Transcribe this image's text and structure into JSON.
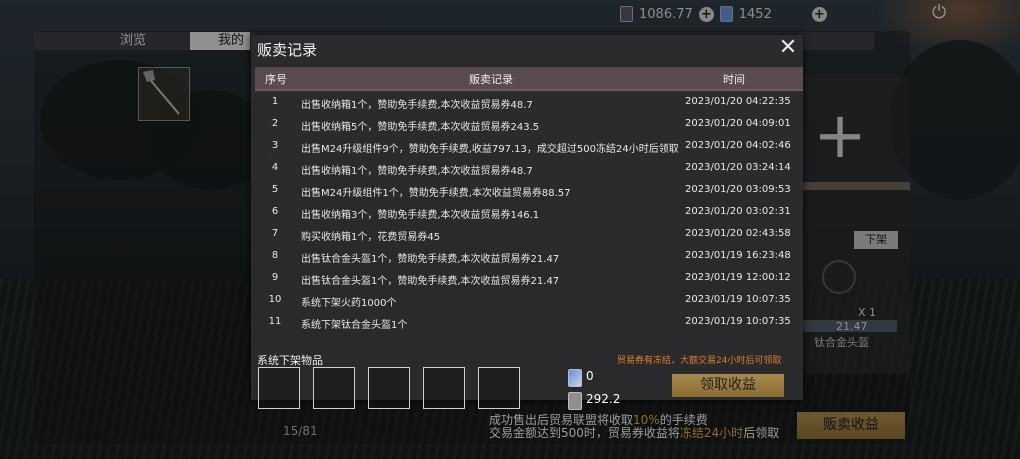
{
  "topbar": {
    "coins": "1086.77",
    "gems": "1452"
  },
  "base": {
    "tabs": [
      "浏览",
      "我的"
    ],
    "slot_count": "1",
    "remove_label": "下架",
    "helmet_qty": "X 1",
    "helmet_price": "21.47",
    "helmet_name": "钛合金头盔",
    "item_count": "15/81",
    "fee_note_line1_a": "成功售出后贸易联盟将收取",
    "fee_note_line1_pct": "10%",
    "fee_note_line1_b": "的手续费",
    "fee_note_line2_a": "交易金额达到500时，贸易券收益将",
    "fee_note_line2_hl": "冻结24小时",
    "fee_note_line2_b": "后领取",
    "sell_income_label": "贩卖收益"
  },
  "modal": {
    "title": "贩卖记录",
    "columns": {
      "index": "序号",
      "record": "贩卖记录",
      "time": "时间"
    },
    "rows": [
      {
        "idx": "1",
        "record": "出售收纳箱1个，赞助免手续费,本次收益贸易券48.7",
        "time": "2023/01/20 04:22:35"
      },
      {
        "idx": "2",
        "record": "出售收纳箱5个，赞助免手续费,本次收益贸易券243.5",
        "time": "2023/01/20 04:09:01"
      },
      {
        "idx": "3",
        "record": "出售M24升级组件9个，赞助免手续费,收益797.13，成交超过500冻结24小时后领取",
        "time": "2023/01/20 04:02:46"
      },
      {
        "idx": "4",
        "record": "出售收纳箱1个，赞助免手续费,本次收益贸易券48.7",
        "time": "2023/01/20 03:24:14"
      },
      {
        "idx": "5",
        "record": "出售M24升级组件1个，赞助免手续费,本次收益贸易券88.57",
        "time": "2023/01/20 03:09:53"
      },
      {
        "idx": "6",
        "record": "出售收纳箱3个，赞助免手续费,本次收益贸易券146.1",
        "time": "2023/01/20 03:02:31"
      },
      {
        "idx": "7",
        "record": "购买收纳箱1个，花费贸易券45",
        "time": "2023/01/20 02:43:58"
      },
      {
        "idx": "8",
        "record": "出售钛合金头盔1个，赞助免手续费,本次收益贸易券21.47",
        "time": "2023/01/19 16:23:48"
      },
      {
        "idx": "9",
        "record": "出售钛合金头盔1个，赞助免手续费,本次收益贸易券21.47",
        "time": "2023/01/19 12:00:12"
      },
      {
        "idx": "10",
        "record": "系统下架火药1000个",
        "time": "2023/01/19 10:07:35"
      },
      {
        "idx": "11",
        "record": "系统下架钛合金头盔1个",
        "time": "2023/01/19 10:07:35"
      }
    ],
    "footer": {
      "label": "系统下架物品",
      "notice": "贸易券有冻结，大额交易24小时后可领取",
      "ticket_value": "0",
      "coin_value": "292.2",
      "claim_label": "领取收益"
    }
  },
  "colors": {
    "accent_gold": "#a8894c",
    "notice_orange": "#e07d28",
    "header_mauve": "#5a4a52"
  }
}
